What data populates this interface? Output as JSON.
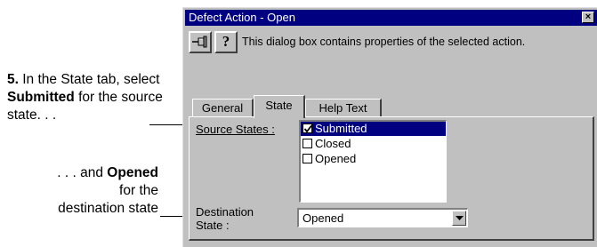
{
  "annotations": {
    "step": {
      "num": "5.",
      "t1": " In the State tab, select ",
      "b1": "Submitted",
      "t2": " for the source state. . ."
    },
    "dest": {
      "t1": ". . . and ",
      "b1": "Opened",
      "t2": "for the",
      "t3": "destination state"
    }
  },
  "dialog": {
    "title": "Defect Action - Open",
    "close": "×",
    "help_glyph": "?",
    "help_description": "This dialog box contains properties of the selected action.",
    "tabs": [
      "General",
      "State",
      "Help Text"
    ],
    "source_states": {
      "label": "Source States :",
      "items": [
        {
          "label": "Submitted",
          "checked": true,
          "selected": true
        },
        {
          "label": "Closed",
          "checked": false,
          "selected": false
        },
        {
          "label": "Opened",
          "checked": false,
          "selected": false
        }
      ]
    },
    "destination_state": {
      "label": "Destination State :",
      "value": "Opened"
    }
  }
}
